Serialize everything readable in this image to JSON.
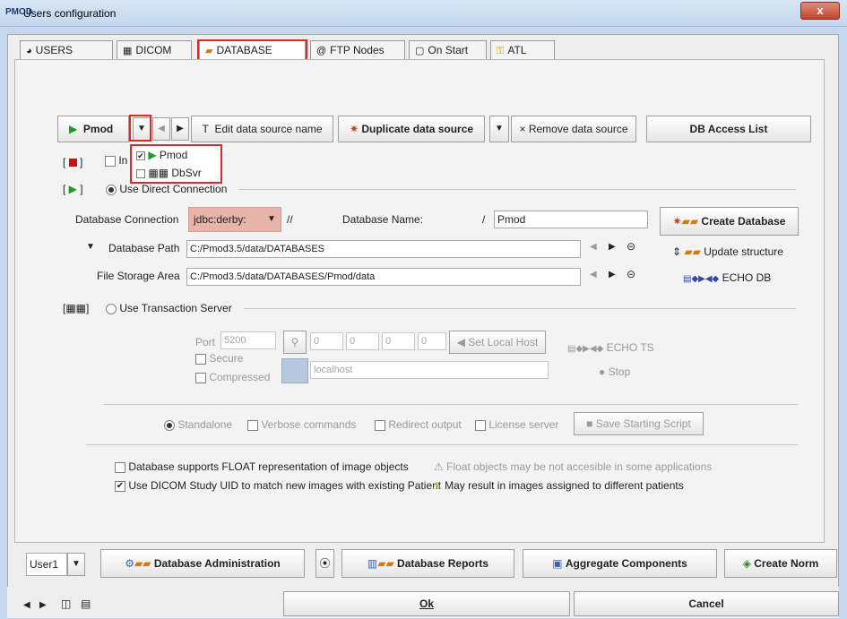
{
  "window": {
    "title": "Users configuration",
    "close": "x",
    "title_icon": "PMOD"
  },
  "tabs": [
    {
      "label": "USERS",
      "icon": "users-icon",
      "glyph": "◕"
    },
    {
      "label": "DICOM",
      "icon": "dicom-icon",
      "glyph": "▦"
    },
    {
      "label": "DATABASE",
      "icon": "database-icon",
      "glyph": "▰"
    },
    {
      "label": "FTP Nodes",
      "icon": "at-icon",
      "glyph": "@"
    },
    {
      "label": "On Start",
      "icon": "window-icon",
      "glyph": "▢"
    },
    {
      "label": "ATL",
      "icon": "key-icon",
      "glyph": "⚿"
    }
  ],
  "toolbar": {
    "source_name": "Pmod",
    "edit_name": "Edit data source name",
    "edit_prefix": "T",
    "duplicate": "Duplicate data source",
    "remove": "Remove data source",
    "remove_prefix": "×",
    "access_list": "DB Access List"
  },
  "dropdown": {
    "items": [
      {
        "label": "Pmod",
        "checked": true,
        "icon": "play-icon"
      },
      {
        "label": "DbSvr",
        "checked": false,
        "icon": "server-icon"
      }
    ]
  },
  "sections": {
    "in_label": "In",
    "direct": "Use Direct Connection",
    "transaction": "Use Transaction Server"
  },
  "direct": {
    "conn_label": "Database Connection",
    "conn_value": "jdbc:derby:",
    "conn_sep": "//",
    "name_label": "Database Name:",
    "name_sep": "/",
    "name_value": "Pmod",
    "create_db": "Create Database",
    "path_label": "Database Path",
    "path_value": "C:/Pmod3.5/data/DATABASES",
    "update_structure": "Update structure",
    "storage_label": "File Storage Area",
    "storage_value": "C:/Pmod3.5/data/DATABASES/Pmod/data",
    "echo_db": "ECHO DB"
  },
  "transaction": {
    "port_label": "Port",
    "port_value": "5200",
    "ip": [
      "0",
      "0",
      "0",
      "0"
    ],
    "set_local": "Set Local Host",
    "secure": "Secure",
    "compressed": "Compressed",
    "host_value": "localhost",
    "echo_ts": "ECHO TS",
    "stop": "Stop"
  },
  "server_opts": {
    "standalone": "Standalone",
    "verbose": "Verbose commands",
    "redirect": "Redirect output",
    "license": "License server",
    "save_script": "Save Starting Script"
  },
  "options": {
    "float_label": "Database supports FLOAT representation of image objects",
    "float_checked": false,
    "float_warn": "Float objects may be not accesible in some applications",
    "uid_label": "Use DICOM Study UID to match new images with existing Patient",
    "uid_checked": true,
    "uid_warn": "May result in images assigned to different patients"
  },
  "bottom": {
    "user": "User1",
    "admin": "Database Administration",
    "reports": "Database Reports",
    "aggregate": "Aggregate Components",
    "create_norm": "Create Norm"
  },
  "footer": {
    "ok": "Ok",
    "cancel": "Cancel"
  }
}
